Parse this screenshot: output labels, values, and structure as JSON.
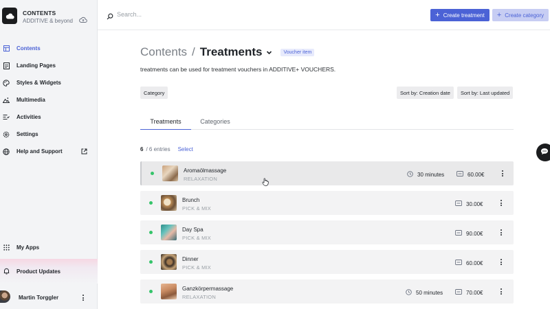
{
  "sidebar": {
    "brand_title": "CONTENTS",
    "brand_subtitle": "ADDITIVE & beyond",
    "items": [
      {
        "label": "Contents",
        "icon": "layout-icon",
        "active": true
      },
      {
        "label": "Landing Pages",
        "icon": "document-icon"
      },
      {
        "label": "Styles & Widgets",
        "icon": "palette-icon"
      },
      {
        "label": "Multimedia",
        "icon": "image-icon"
      },
      {
        "label": "Activities",
        "icon": "activities-icon"
      },
      {
        "label": "Settings",
        "icon": "gear-icon"
      },
      {
        "label": "Help and Support",
        "icon": "globe-icon",
        "external": true
      }
    ],
    "my_apps": "My Apps",
    "product_updates": "Product Updates",
    "user_name": "Martin Torggler"
  },
  "topbar": {
    "search_placeholder": "Search...",
    "create_treatment": "Create treatment",
    "create_category": "Create category"
  },
  "page": {
    "breadcrumb_parent": "Contents",
    "breadcrumb_separator": "/",
    "title": "Treatments",
    "badge": "Voucher item",
    "description": "treatments can be used for treatment vouchers in ADDITIVE+ VOUCHERS."
  },
  "filters": {
    "category": "Category",
    "sort_creation": "Sort by: Creation date",
    "sort_updated": "Sort by: Last updated"
  },
  "tabs": [
    {
      "label": "Treatments",
      "active": true
    },
    {
      "label": "Categories",
      "active": false
    }
  ],
  "entries": {
    "count": "6",
    "total": "/ 6 entries",
    "select": "Select"
  },
  "rows": [
    {
      "name": "Aromaölmassage",
      "category": "RELAXATION",
      "duration": "30 minutes",
      "price": "60.00€",
      "status_color": "#35c46a"
    },
    {
      "name": "Brunch",
      "category": "PICK & MIX",
      "duration": "",
      "price": "30.00€",
      "status_color": "#35c46a"
    },
    {
      "name": "Day Spa",
      "category": "PICK & MIX",
      "duration": "",
      "price": "90.00€",
      "status_color": "#35c46a"
    },
    {
      "name": "Dinner",
      "category": "PICK & MIX",
      "duration": "",
      "price": "60.00€",
      "status_color": "#35c46a"
    },
    {
      "name": "Ganzkörpermassage",
      "category": "RELAXATION",
      "duration": "50 minutes",
      "price": "70.00€",
      "status_color": "#35c46a"
    }
  ],
  "colors": {
    "accent": "#4b62d6",
    "accent_soft": "#c7cdf3",
    "status_active": "#35c46a"
  }
}
